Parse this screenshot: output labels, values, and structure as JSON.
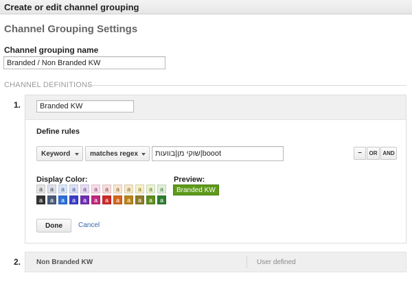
{
  "window": {
    "title": "Create or edit channel grouping"
  },
  "settings": {
    "heading": "Channel Grouping Settings",
    "name_label": "Channel grouping name",
    "name_value": "Branded / Non Branded KW"
  },
  "definitions": {
    "header": "CHANNEL DEFINITIONS",
    "items": [
      {
        "number": "1.",
        "channel_name": "Branded KW",
        "define_rules_label": "Define rules",
        "rule": {
          "dimension": "Keyword",
          "operator": "matches regex",
          "value": "שוקי מן|בוועות|booot"
        },
        "buttons": {
          "minus": "–",
          "or": "OR",
          "and": "AND"
        },
        "display_color_label": "Display Color:",
        "preview_label": "Preview:",
        "preview_text": "Branded KW",
        "swatch_glyph": "a",
        "swatches": {
          "light": [
            {
              "bg": "#e4e4e4",
              "fg": "#444444"
            },
            {
              "bg": "#dde0ea",
              "fg": "#444444"
            },
            {
              "bg": "#d8e6f7",
              "fg": "#446688"
            },
            {
              "bg": "#dcdff6",
              "fg": "#445599"
            },
            {
              "bg": "#e6dcf2",
              "fg": "#664488"
            },
            {
              "bg": "#f6dcea",
              "fg": "#884466"
            },
            {
              "bg": "#f8dcdc",
              "fg": "#884444"
            },
            {
              "bg": "#f8e6d0",
              "fg": "#886633"
            },
            {
              "bg": "#f4e8c8",
              "fg": "#886622"
            },
            {
              "bg": "#f6f0c8",
              "fg": "#887722"
            },
            {
              "bg": "#eaf2cf",
              "fg": "#667733"
            },
            {
              "bg": "#dff0d8",
              "fg": "#447744"
            }
          ],
          "dark": [
            {
              "bg": "#333333",
              "fg": "#ffffff"
            },
            {
              "bg": "#4a5a78",
              "fg": "#ffffff"
            },
            {
              "bg": "#2b6fd6",
              "fg": "#ffffff"
            },
            {
              "bg": "#3c3cc8",
              "fg": "#ffffff"
            },
            {
              "bg": "#6f2fb0",
              "fg": "#ffffff"
            },
            {
              "bg": "#c0287a",
              "fg": "#ffffff"
            },
            {
              "bg": "#cc2a2a",
              "fg": "#ffffff"
            },
            {
              "bg": "#d4661e",
              "fg": "#ffffff"
            },
            {
              "bg": "#b8821a",
              "fg": "#ffffff"
            },
            {
              "bg": "#8c7a2a",
              "fg": "#ffffff"
            },
            {
              "bg": "#5e8c1e",
              "fg": "#ffffff"
            },
            {
              "bg": "#2e7d32",
              "fg": "#ffffff"
            }
          ]
        },
        "done_label": "Done",
        "cancel_label": "Cancel"
      },
      {
        "number": "2.",
        "channel_name": "Non Branded KW",
        "type": "User defined"
      }
    ]
  },
  "colors": {
    "preview_bg": "#5e9a1b",
    "link": "#3366aa"
  }
}
